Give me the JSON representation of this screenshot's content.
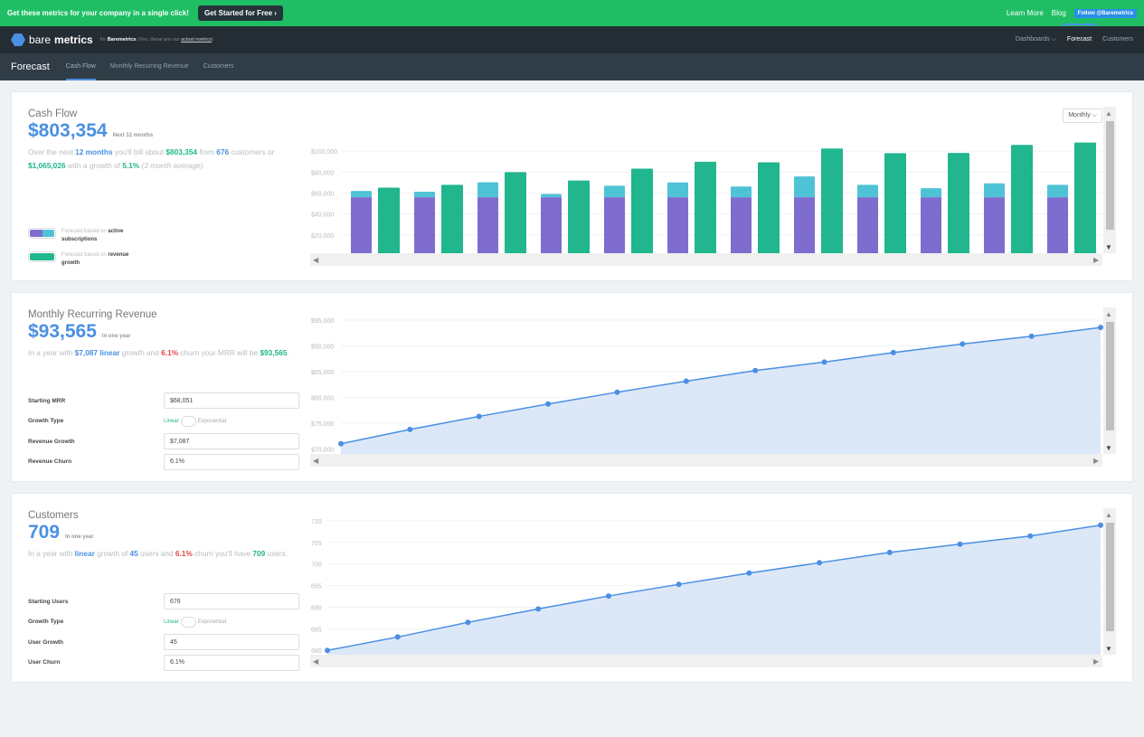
{
  "promo": {
    "text": "Get these metrics for your company in a single click!",
    "cta": "Get Started for Free ›",
    "learn": "Learn More",
    "blog": "Blog",
    "twitter": "Follow @Baremetrics"
  },
  "nav": {
    "brand_a": "bare",
    "brand_b": "metrics",
    "for": "for",
    "company": "Baremetrics",
    "note": "(Yes, these are our",
    "note_link": "actual metrics",
    "note_end": ")",
    "items": [
      "Dashboards ⌵",
      "Forecast",
      "Customers"
    ]
  },
  "subnav": {
    "title": "Forecast",
    "tabs": [
      "Cash Flow",
      "Monthly Recurring Revenue",
      "Customers"
    ]
  },
  "cashflow": {
    "title": "Cash Flow",
    "value": "$803,354",
    "value_note": "Next 12 months",
    "desc": [
      "Over the next ",
      "12 months",
      " you'll bill about ",
      "$803,354",
      " from ",
      "676",
      " customers or ",
      "$1,065,026",
      " with a growth of ",
      "5.1%",
      " (3 month average)."
    ],
    "legend": [
      {
        "pre": "Forecast based on ",
        "bold": "active subscriptions"
      },
      {
        "pre": "Forecast based on ",
        "bold": "revenue growth"
      }
    ],
    "period": "Monthly"
  },
  "mrr": {
    "title": "Monthly Recurring Revenue",
    "value": "$93,565",
    "value_note": "In one year",
    "desc": [
      "In a year with ",
      "$7,087 linear",
      " growth and ",
      "6.1%",
      " churn your MRR will be ",
      "$93,565",
      "."
    ],
    "fields": {
      "starting_label": "Starting MRR",
      "starting": "$68,051",
      "type_label": "Growth Type",
      "linear": "Linear",
      "exponential": "Exponential",
      "growth_label": "Revenue Growth",
      "growth": "$7,087",
      "churn_label": "Revenue Churn",
      "churn": "6.1%"
    }
  },
  "customers": {
    "title": "Customers",
    "value": "709",
    "value_note": "In one year",
    "desc": [
      "In a year with ",
      "linear",
      " growth of ",
      "45",
      " users and ",
      "6.1%",
      " churn you'll have ",
      "709",
      " users."
    ],
    "fields": {
      "starting_label": "Starting Users",
      "starting": "676",
      "type_label": "Growth Type",
      "linear": "Linear",
      "exponential": "Exponential",
      "growth_label": "User Growth",
      "growth": "45",
      "churn_label": "User Churn",
      "churn": "6.1%"
    }
  },
  "colors": {
    "purple": "#7e6dce",
    "cyan": "#4fc3d6",
    "green": "#21b68d",
    "line": "#4a8fe3",
    "area": "#dce8f8"
  },
  "chart_data": [
    {
      "type": "bar",
      "stacked_series": [
        {
          "values": [
            56000,
            56000,
            56000,
            56000,
            56000,
            56000,
            56000,
            56000,
            56000,
            56000,
            56000,
            56000
          ]
        },
        {
          "values": [
            6000,
            5300,
            14400,
            3100,
            11000,
            14100,
            10300,
            19900,
            11900,
            8600,
            13300,
            11900
          ]
        }
      ],
      "series": [
        {
          "values": [
            65200,
            67900,
            80000,
            72000,
            83300,
            89900,
            89300,
            102500,
            98100,
            98300,
            106000,
            108200
          ]
        }
      ],
      "yticks": [
        "$20,000",
        "$40,000",
        "$60,000",
        "$80,000",
        "$100,000"
      ],
      "ylim": [
        0,
        120000
      ],
      "grid": true
    },
    {
      "type": "area",
      "values": [
        70980,
        73760,
        76300,
        78700,
        81000,
        83150,
        85200,
        86850,
        88700,
        90370,
        91850,
        93565
      ],
      "yticks": [
        "$70,000",
        "$75,000",
        "$80,000",
        "$85,000",
        "$90,000",
        "$95,000"
      ],
      "ylim": [
        69000,
        95000
      ],
      "grid": true
    },
    {
      "type": "area",
      "values": [
        680,
        683.1,
        686.5,
        689.6,
        692.6,
        695.3,
        697.9,
        700.3,
        702.7,
        704.6,
        706.5,
        709
      ],
      "yticks": [
        "680",
        "685",
        "690",
        "695",
        "700",
        "705",
        "710"
      ],
      "ylim": [
        679,
        710
      ],
      "grid": true
    }
  ]
}
